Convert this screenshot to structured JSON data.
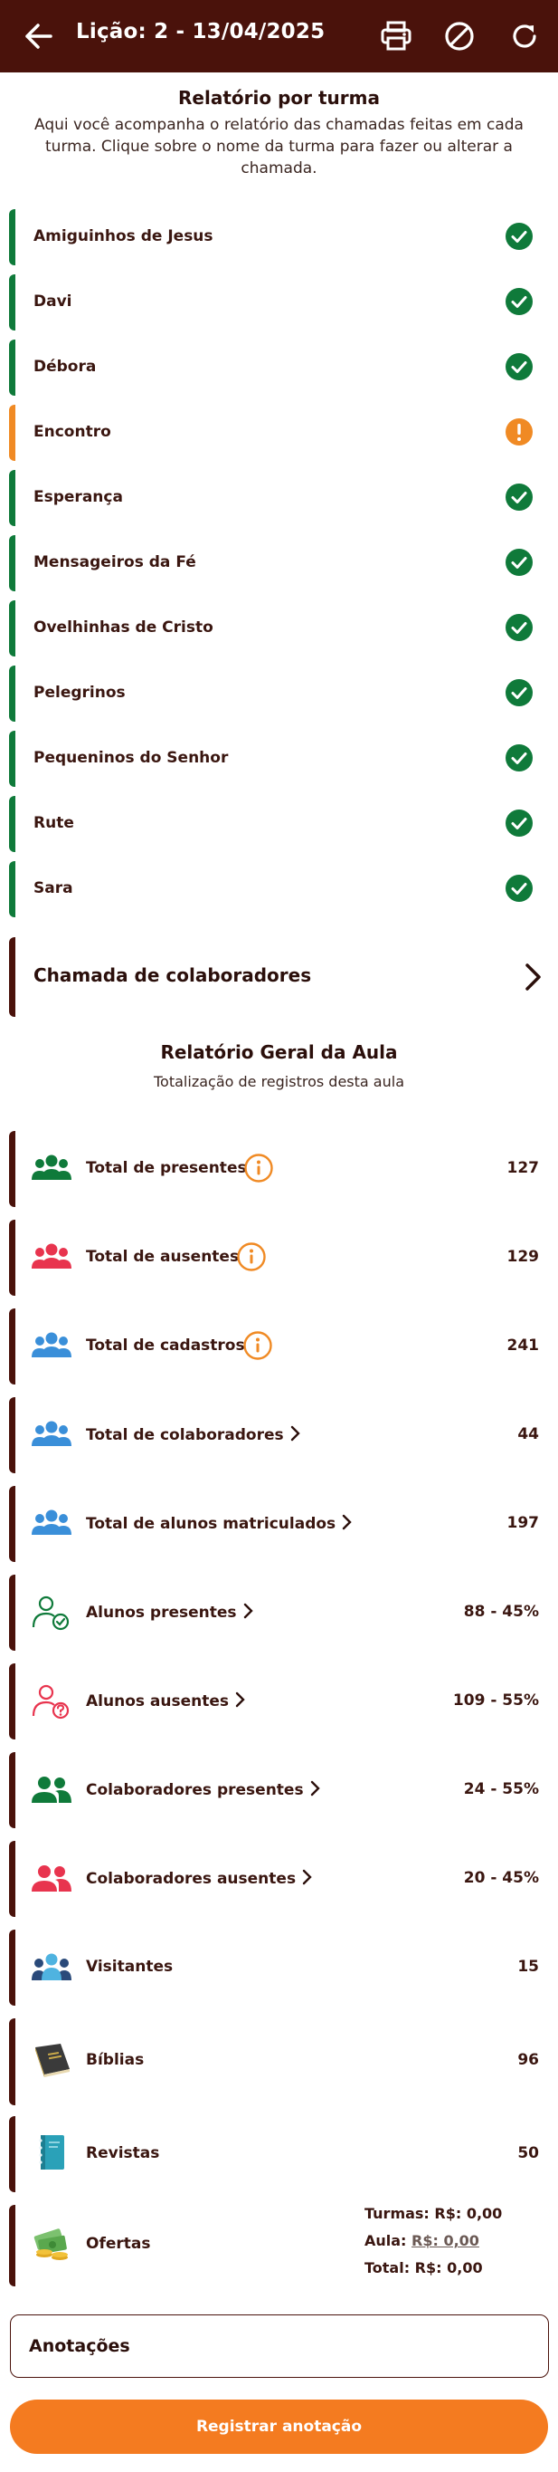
{
  "header": {
    "title": "Lição: 2 - 13/04/2025",
    "back_icon": "arrow-left-icon",
    "print_icon": "printer-icon",
    "block_icon": "block-icon",
    "refresh_icon": "refresh-icon",
    "bg_color": "#4a120b"
  },
  "class_report": {
    "title": "Relatório por turma",
    "subtitle": "Aqui você acompanha o relatório das chamadas feitas em cada turma. Clique sobre o nome da turma para fazer ou alterar a chamada.",
    "classes": [
      {
        "name": "Amiguinhos de Jesus",
        "status": "done"
      },
      {
        "name": "Davi",
        "status": "done"
      },
      {
        "name": "Débora",
        "status": "done"
      },
      {
        "name": "Encontro",
        "status": "pending"
      },
      {
        "name": "Esperança",
        "status": "done"
      },
      {
        "name": "Mensageiros da Fé",
        "status": "done"
      },
      {
        "name": "Ovelhinhas de Cristo",
        "status": "done"
      },
      {
        "name": "Pelegrinos",
        "status": "done"
      },
      {
        "name": "Pequeninos do Senhor",
        "status": "done"
      },
      {
        "name": "Rute",
        "status": "done"
      },
      {
        "name": "Sara",
        "status": "done"
      }
    ],
    "done_color": "#0f7a3a",
    "pending_color": "#f08a24"
  },
  "collaborators_call": {
    "label": "Chamada de colaboradores"
  },
  "general_report": {
    "title": "Relatório Geral da Aula",
    "subtitle": "Totalização de registros desta aula",
    "stats": [
      {
        "label": "Total de presentes",
        "value": "127",
        "icon": "group-green-icon"
      },
      {
        "label": "Total de ausentes",
        "value": "129",
        "icon": "group-red-icon"
      },
      {
        "label": "Total de cadastros",
        "value": "241",
        "icon": "group-blue-icon"
      },
      {
        "label": "Total de colaboradores",
        "value": "44",
        "icon": "group-blue-icon"
      },
      {
        "label": "Total de alunos matriculados",
        "value": "197",
        "icon": "group-blue-icon"
      },
      {
        "label": "Alunos presentes",
        "value": "88 - 45%",
        "icon": "person-check-icon"
      },
      {
        "label": "Alunos ausentes",
        "value": "109 - 55%",
        "icon": "person-question-icon"
      },
      {
        "label": "Colaboradores presentes",
        "value": "24 - 55%",
        "icon": "pair-green-icon"
      },
      {
        "label": "Colaboradores ausentes",
        "value": "20 - 45%",
        "icon": "pair-red-icon"
      },
      {
        "label": "Visitantes",
        "value": "15",
        "icon": "visitors-icon"
      },
      {
        "label": "Bíblias",
        "value": "96",
        "icon": "bible-icon"
      },
      {
        "label": "Revistas",
        "value": "50",
        "icon": "magazine-icon"
      }
    ],
    "ofertas": {
      "label": "Ofertas",
      "icon": "money-icon",
      "turmas": "Turmas: R$: 0,00",
      "aula_prefix": "Aula: ",
      "aula_value": "R$: 0,00",
      "total": "Total: R$: 0,00"
    }
  },
  "notes": {
    "label": "Anotações"
  },
  "register_button": {
    "label": "Registrar anotação",
    "color": "#f47b20"
  }
}
